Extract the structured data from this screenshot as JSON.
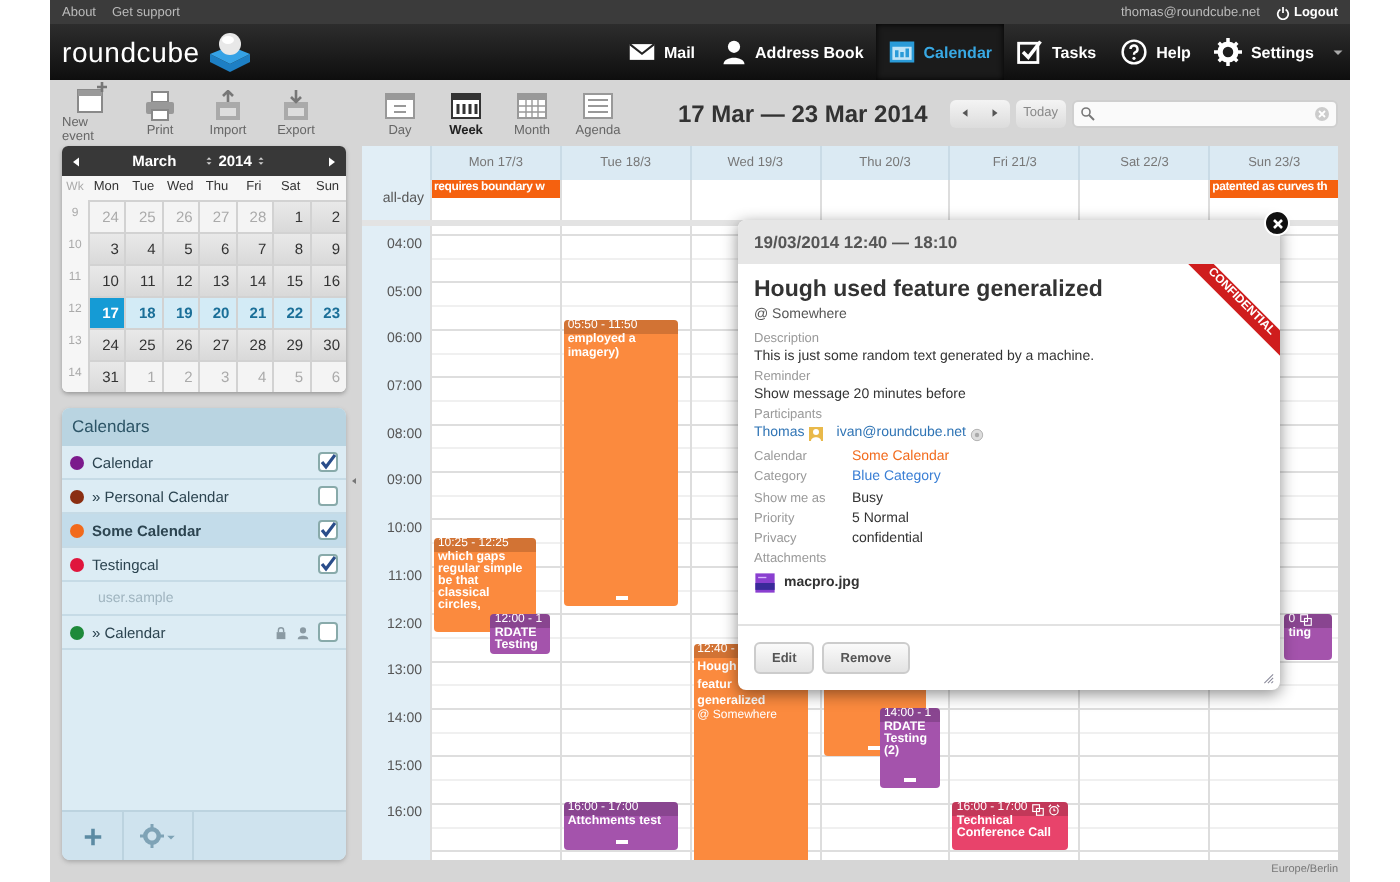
{
  "topbar": {
    "links": [
      "About",
      "Get support"
    ],
    "user": "thomas@roundcube.net",
    "logout": "Logout"
  },
  "header": {
    "logo": "roundcube",
    "nav": [
      {
        "label": "Mail",
        "selected": false
      },
      {
        "label": "Address Book",
        "selected": false
      },
      {
        "label": "Calendar",
        "selected": true
      },
      {
        "label": "Tasks",
        "selected": false
      },
      {
        "label": "Help",
        "selected": false
      },
      {
        "label": "Settings",
        "selected": false
      }
    ]
  },
  "toolbar": [
    "New event",
    "Print",
    "Import",
    "Export"
  ],
  "views": [
    {
      "label": "Day",
      "selected": false
    },
    {
      "label": "Week",
      "selected": true
    },
    {
      "label": "Month",
      "selected": false
    },
    {
      "label": "Agenda",
      "selected": false
    }
  ],
  "range_title": "17 Mar — 23 Mar 2014",
  "today": "Today",
  "minical": {
    "month": "March",
    "year": "2014",
    "week_label": "Wk",
    "weekdays": [
      "Mon",
      "Tue",
      "Wed",
      "Thu",
      "Fri",
      "Sat",
      "Sun"
    ],
    "weeks": [
      {
        "wk": "9",
        "days": [
          {
            "date": "24",
            "kind": "other",
            "selected": false
          },
          {
            "date": "25",
            "kind": "other",
            "selected": false
          },
          {
            "date": "26",
            "kind": "other",
            "selected": false
          },
          {
            "date": "27",
            "kind": "other",
            "selected": false
          },
          {
            "date": "28",
            "kind": "other",
            "selected": false
          },
          {
            "date": "1",
            "kind": "day",
            "selected": false
          },
          {
            "date": "2",
            "kind": "day",
            "selected": false
          }
        ]
      },
      {
        "wk": "10",
        "days": [
          {
            "date": "3",
            "kind": "day",
            "selected": false
          },
          {
            "date": "4",
            "kind": "day",
            "selected": false
          },
          {
            "date": "5",
            "kind": "day",
            "selected": false
          },
          {
            "date": "6",
            "kind": "day",
            "selected": false
          },
          {
            "date": "7",
            "kind": "day",
            "selected": false
          },
          {
            "date": "8",
            "kind": "day",
            "selected": false
          },
          {
            "date": "9",
            "kind": "day",
            "selected": false
          }
        ]
      },
      {
        "wk": "11",
        "days": [
          {
            "date": "10",
            "kind": "day",
            "selected": false
          },
          {
            "date": "11",
            "kind": "day",
            "selected": false
          },
          {
            "date": "12",
            "kind": "day",
            "selected": false
          },
          {
            "date": "13",
            "kind": "day",
            "selected": false
          },
          {
            "date": "14",
            "kind": "day",
            "selected": false
          },
          {
            "date": "15",
            "kind": "day",
            "selected": false
          },
          {
            "date": "16",
            "kind": "day",
            "selected": false
          }
        ]
      },
      {
        "wk": "12",
        "days": [
          {
            "date": "17",
            "kind": "range",
            "selected": true
          },
          {
            "date": "18",
            "kind": "range",
            "selected": false
          },
          {
            "date": "19",
            "kind": "range",
            "selected": false
          },
          {
            "date": "20",
            "kind": "range",
            "selected": false
          },
          {
            "date": "21",
            "kind": "range",
            "selected": false
          },
          {
            "date": "22",
            "kind": "range",
            "selected": false
          },
          {
            "date": "23",
            "kind": "range",
            "selected": false
          }
        ]
      },
      {
        "wk": "13",
        "days": [
          {
            "date": "24",
            "kind": "day",
            "selected": false
          },
          {
            "date": "25",
            "kind": "day",
            "selected": false
          },
          {
            "date": "26",
            "kind": "day",
            "selected": false
          },
          {
            "date": "27",
            "kind": "day",
            "selected": false
          },
          {
            "date": "28",
            "kind": "day",
            "selected": false
          },
          {
            "date": "29",
            "kind": "day",
            "selected": false
          },
          {
            "date": "30",
            "kind": "day",
            "selected": false
          }
        ]
      },
      {
        "wk": "14",
        "days": [
          {
            "date": "31",
            "kind": "day",
            "selected": false
          },
          {
            "date": "1",
            "kind": "other",
            "selected": false
          },
          {
            "date": "2",
            "kind": "other",
            "selected": false
          },
          {
            "date": "3",
            "kind": "other",
            "selected": false
          },
          {
            "date": "4",
            "kind": "other",
            "selected": false
          },
          {
            "date": "5",
            "kind": "other",
            "selected": false
          },
          {
            "date": "6",
            "kind": "other",
            "selected": false
          }
        ]
      }
    ]
  },
  "calendars": {
    "title": "Calendars",
    "items": [
      {
        "kind": "calendar",
        "name": "Calendar",
        "color": "#7b1a8c",
        "checked": true,
        "selected": false,
        "readonly": false
      },
      {
        "kind": "calendar",
        "name": "» Personal Calendar",
        "color": "#8a2e12",
        "checked": false,
        "selected": false,
        "readonly": false
      },
      {
        "kind": "calendar",
        "name": "Some Calendar",
        "color": "#f26a1b",
        "checked": true,
        "selected": true,
        "readonly": false
      },
      {
        "kind": "calendar",
        "name": "Testingcal",
        "color": "#e0163d",
        "checked": true,
        "selected": false,
        "readonly": false
      },
      {
        "kind": "group",
        "name": "user.sample"
      },
      {
        "kind": "calendar",
        "name": "» Calendar",
        "color": "#1e8a3a",
        "checked": false,
        "selected": false,
        "readonly": true
      }
    ]
  },
  "week": {
    "all_day_label": "all-day",
    "hours": [
      "04:00",
      "05:00",
      "06:00",
      "07:00",
      "08:00",
      "09:00",
      "10:00",
      "11:00",
      "12:00",
      "13:00",
      "14:00",
      "15:00",
      "16:00"
    ],
    "days": [
      {
        "label": "Mon 17/3",
        "all_day": [
          {
            "title": "requires boundary w",
            "color": "#f5610f"
          }
        ],
        "events": [
          {
            "kind": "timed",
            "time": "10:25 - 12:25",
            "title": "which gaps regular simple be that classical circles,",
            "color": "#fb8a3e"
          },
          {
            "kind": "timed",
            "time": "12:00 - 1",
            "title": "RDATE Testing",
            "color": "#a453ac"
          }
        ]
      },
      {
        "label": "Tue 18/3",
        "events": [
          {
            "kind": "timed",
            "time": "05:50 - 11:50",
            "title": "employed a imagery)",
            "color": "#fb8a3e",
            "handle": true
          },
          {
            "kind": "timed",
            "time": "16:00 - 17:00",
            "title": "Attchments test",
            "color": "#a453ac",
            "handle": true
          }
        ]
      },
      {
        "label": "Wed 19/3",
        "events": [
          {
            "kind": "timed",
            "time": "12:40 -",
            "title": [
              "Hough",
              "featur",
              "generalized"
            ],
            "location": "@ Somewhere",
            "color": "#fb8a3e",
            "open": true
          }
        ]
      },
      {
        "label": "Thu 20/3",
        "events": [
          {
            "kind": "covered",
            "color": "#fb8a3e",
            "handle": true
          },
          {
            "kind": "timed",
            "time": "14:00 - 1",
            "title": "RDATE Testing (2)",
            "color": "#a453ac",
            "handle": true
          }
        ]
      },
      {
        "label": "Fri 21/3",
        "events": [
          {
            "kind": "timed",
            "time": "16:00 - 17:00",
            "title": "Technical Conference Call",
            "color": "#e8436b",
            "recurring": true,
            "alarm": true
          }
        ]
      },
      {
        "label": "Sat 22/3"
      },
      {
        "label": "Sun 23/3",
        "all_day": [
          {
            "title": "patented as curves th",
            "color": "#f5610f"
          }
        ],
        "events": [
          {
            "kind": "peek",
            "time": "0",
            "title": "ting",
            "color": "#a453ac",
            "recurring": true
          }
        ]
      }
    ]
  },
  "popup": {
    "date": "19/03/2014 12:40 — 18:10",
    "ribbon": "CONFIDENTIAL",
    "title": "Hough used feature generalized",
    "location": "@ Somewhere",
    "sections": [
      {
        "label": "Description",
        "value": "This is just some random text generated by a machine."
      },
      {
        "label": "Reminder",
        "value": "Show message 20 minutes before"
      }
    ],
    "participants_label": "Participants",
    "participants": [
      {
        "name": "Thomas",
        "kind": "organizer"
      },
      {
        "name": "ivan@roundcube.net",
        "kind": "attendee"
      }
    ],
    "details": [
      {
        "label": "Calendar",
        "value": "Some Calendar",
        "color": "#f26a1b"
      },
      {
        "label": "Category",
        "value": "Blue Category",
        "color": "#3a7fd5"
      },
      {
        "label": "Show me as",
        "value": "Busy"
      },
      {
        "label": "Priority",
        "value": "5 Normal"
      },
      {
        "label": "Privacy",
        "value": "confidential"
      }
    ],
    "attachments_label": "Attachments",
    "attachments": [
      "macpro.jpg"
    ],
    "buttons": [
      "Edit",
      "Remove"
    ]
  },
  "timezone": "Europe/Berlin"
}
